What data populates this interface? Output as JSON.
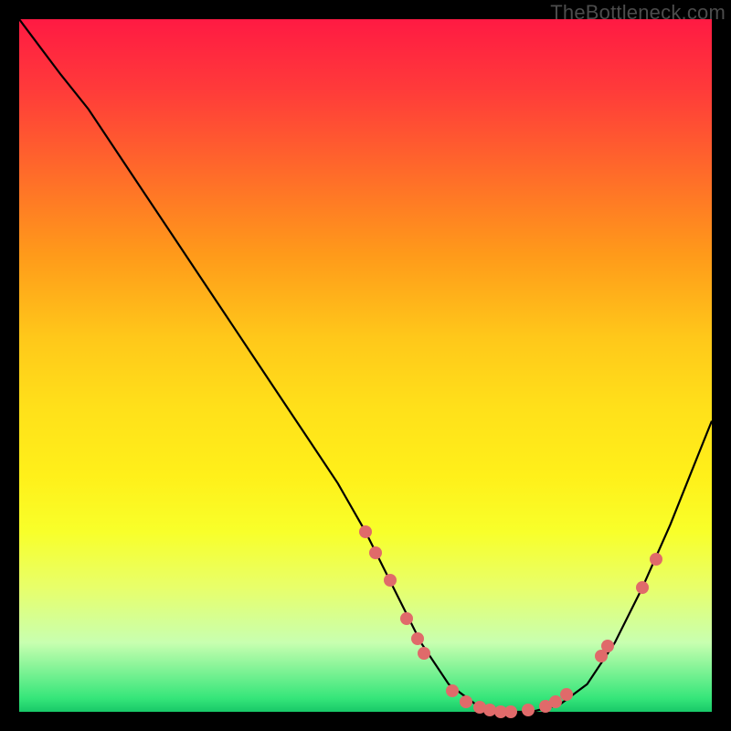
{
  "watermark": "TheBottleneck.com",
  "colors": {
    "dot": "#e06a6a",
    "curve": "#000000",
    "frame": "#000000"
  },
  "chart_data": {
    "type": "line",
    "title": "",
    "xlabel": "",
    "ylabel": "",
    "xlim": [
      0,
      100
    ],
    "ylim": [
      0,
      100
    ],
    "grid": false,
    "series": [
      {
        "name": "bottleneck-curve",
        "x": [
          0,
          3,
          6,
          10,
          14,
          18,
          22,
          26,
          30,
          34,
          38,
          42,
          46,
          50,
          54,
          58,
          62,
          66,
          70,
          74,
          78,
          82,
          86,
          90,
          94,
          98,
          100
        ],
        "y": [
          100,
          96,
          92,
          87,
          81,
          75,
          69,
          63,
          57,
          51,
          45,
          39,
          33,
          26,
          18,
          10,
          4,
          1,
          0,
          0,
          1,
          4,
          10,
          18,
          27,
          37,
          42
        ]
      }
    ],
    "points": [
      {
        "x": 50.0,
        "y": 26.0
      },
      {
        "x": 51.5,
        "y": 23.0
      },
      {
        "x": 53.5,
        "y": 19.0
      },
      {
        "x": 56.0,
        "y": 13.5
      },
      {
        "x": 57.5,
        "y": 10.5
      },
      {
        "x": 58.5,
        "y": 8.5
      },
      {
        "x": 62.5,
        "y": 3.0
      },
      {
        "x": 64.5,
        "y": 1.5
      },
      {
        "x": 66.5,
        "y": 0.6
      },
      {
        "x": 68.0,
        "y": 0.2
      },
      {
        "x": 69.5,
        "y": 0.0
      },
      {
        "x": 71.0,
        "y": 0.0
      },
      {
        "x": 73.5,
        "y": 0.2
      },
      {
        "x": 76.0,
        "y": 0.8
      },
      {
        "x": 77.5,
        "y": 1.5
      },
      {
        "x": 79.0,
        "y": 2.5
      },
      {
        "x": 84.0,
        "y": 8.0
      },
      {
        "x": 85.0,
        "y": 9.5
      },
      {
        "x": 90.0,
        "y": 18.0
      },
      {
        "x": 92.0,
        "y": 22.0
      }
    ],
    "notes": "Axes are un-labeled in the source image; x/y are expressed as 0–100 percent of the plot box. The curve descends steeply from upper-left, flattens near zero around x≈68–76, then rises toward the right edge. Red dots cluster near the valley."
  }
}
